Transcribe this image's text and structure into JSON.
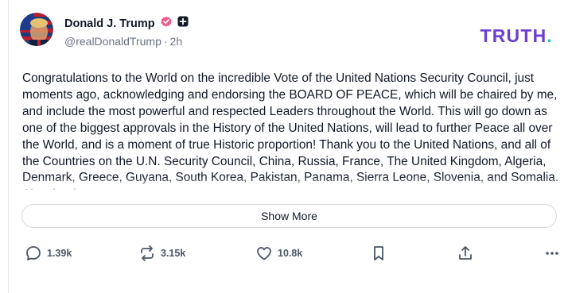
{
  "post": {
    "author_name": "Donald J. Trump",
    "handle": "@realDonaldTrump",
    "separator": "·",
    "time": "2h",
    "brand": "TRUTH",
    "brand_dot": ".",
    "text": "Congratulations to the World on the incredible Vote of the United Nations Security Council, just moments ago, acknowledging and endorsing the BOARD OF PEACE, which will be chaired by me, and include the most powerful and respected Leaders throughout the World. This will go down as one of the biggest approvals in the History of the United Nations, will lead to further Peace all over the World, and is a moment of true Historic proportion! Thank you to the United Nations, and all of the Countries on the U.N. Security Council, China, Russia, France, The United Kingdom, Algeria, Denmark, Greece, Guyana, South Korea, Pakistan, Panama, Sierra Leone, Slovenia, and Somalia. Also thank",
    "show_more_label": "Show More"
  },
  "actions": {
    "replies": "1.39k",
    "retruths": "3.15k",
    "likes": "10.8k"
  },
  "colors": {
    "brand_purple": "#6b3fd4",
    "brand_teal": "#28c4b4",
    "verified_badge": "#ef5a8a"
  },
  "icons": [
    "verified-badge-icon",
    "plus-badge-icon",
    "reply-icon",
    "retruth-icon",
    "like-icon",
    "bookmark-icon",
    "share-icon",
    "more-options-icon"
  ]
}
